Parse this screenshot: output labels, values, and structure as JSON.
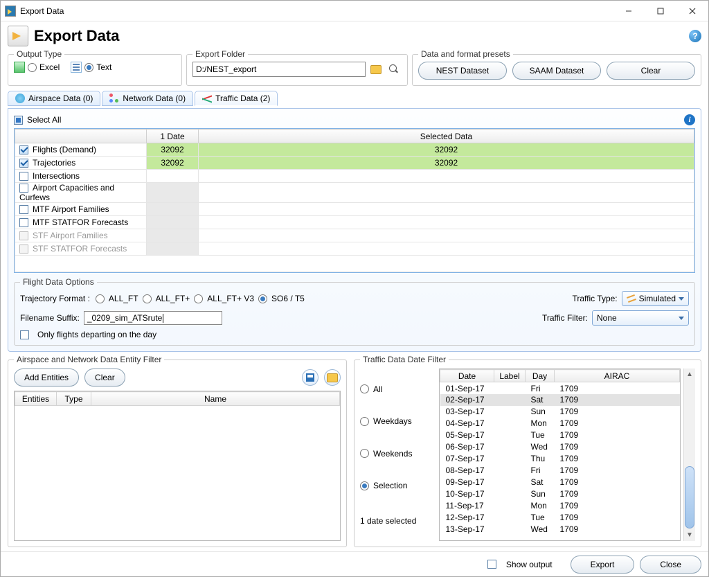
{
  "window": {
    "title": "Export Data",
    "heading": "Export Data"
  },
  "outputType": {
    "legend": "Output Type",
    "excel": "Excel",
    "text": "Text",
    "selected": "text"
  },
  "exportFolder": {
    "legend": "Export Folder",
    "path": "D:/NEST_export"
  },
  "presets": {
    "legend": "Data and format presets",
    "nest": "NEST Dataset",
    "saam": "SAAM Dataset",
    "clear": "Clear"
  },
  "tabs": {
    "airspace": "Airspace Data (0)",
    "network": "Network Data (0)",
    "traffic": "Traffic Data (2)"
  },
  "trafficPanel": {
    "selectAll": "Select All",
    "headers": {
      "date": "1 Date",
      "selected": "Selected Data"
    },
    "rows": [
      {
        "label": "Flights (Demand)",
        "checked": true,
        "date": "32092",
        "sel": "32092"
      },
      {
        "label": "Trajectories",
        "checked": true,
        "date": "32092",
        "sel": "32092"
      },
      {
        "label": "Intersections",
        "checked": false,
        "date": "",
        "sel": ""
      },
      {
        "label": "Airport Capacities and Curfews",
        "checked": false,
        "date": "",
        "sel": "",
        "dimdate": true
      },
      {
        "label": "MTF Airport Families",
        "checked": false,
        "date": "",
        "sel": "",
        "dimdate": true
      },
      {
        "label": "MTF STATFOR Forecasts",
        "checked": false,
        "date": "",
        "sel": "",
        "dimdate": true
      },
      {
        "label": "STF Airport Families",
        "checked": false,
        "date": "",
        "sel": "",
        "disabled": true,
        "dimdate": true
      },
      {
        "label": "STF STATFOR Forecasts",
        "checked": false,
        "date": "",
        "sel": "",
        "disabled": true,
        "dimdate": true
      }
    ]
  },
  "fdo": {
    "legend": "Flight Data Options",
    "trajFormatLabel": "Trajectory Format :",
    "formats": {
      "allft": "ALL_FT",
      "allftp": "ALL_FT+",
      "allftv3": "ALL_FT+ V3",
      "so6": "SO6 / T5"
    },
    "trafficTypeLabel": "Traffic Type:",
    "trafficTypeValue": "Simulated",
    "trafficFilterLabel": "Traffic Filter:",
    "trafficFilterValue": "None",
    "suffixLabel": "Filename Suffix:",
    "suffixValue": "_0209_sim_ATSrute",
    "onlyDepart": "Only flights departing on the day"
  },
  "entityFilter": {
    "legend": "Airspace and Network Data Entity Filter",
    "addEntities": "Add Entities",
    "clear": "Clear",
    "headers": {
      "entities": "Entities",
      "type": "Type",
      "name": "Name"
    }
  },
  "dateFilter": {
    "legend": "Traffic Data Date Filter",
    "radios": {
      "all": "All",
      "weekdays": "Weekdays",
      "weekends": "Weekends",
      "selection": "Selection"
    },
    "headers": {
      "date": "Date",
      "label": "Label",
      "day": "Day",
      "airac": "AIRAC"
    },
    "status": "1 date selected",
    "rows": [
      {
        "date": "01-Sep-17",
        "label": "",
        "day": "Fri",
        "airac": "1709"
      },
      {
        "date": "02-Sep-17",
        "label": "",
        "day": "Sat",
        "airac": "1709",
        "hl": true
      },
      {
        "date": "03-Sep-17",
        "label": "",
        "day": "Sun",
        "airac": "1709"
      },
      {
        "date": "04-Sep-17",
        "label": "",
        "day": "Mon",
        "airac": "1709"
      },
      {
        "date": "05-Sep-17",
        "label": "",
        "day": "Tue",
        "airac": "1709"
      },
      {
        "date": "06-Sep-17",
        "label": "",
        "day": "Wed",
        "airac": "1709"
      },
      {
        "date": "07-Sep-17",
        "label": "",
        "day": "Thu",
        "airac": "1709"
      },
      {
        "date": "08-Sep-17",
        "label": "",
        "day": "Fri",
        "airac": "1709"
      },
      {
        "date": "09-Sep-17",
        "label": "",
        "day": "Sat",
        "airac": "1709"
      },
      {
        "date": "10-Sep-17",
        "label": "",
        "day": "Sun",
        "airac": "1709"
      },
      {
        "date": "11-Sep-17",
        "label": "",
        "day": "Mon",
        "airac": "1709"
      },
      {
        "date": "12-Sep-17",
        "label": "",
        "day": "Tue",
        "airac": "1709"
      },
      {
        "date": "13-Sep-17",
        "label": "",
        "day": "Wed",
        "airac": "1709"
      }
    ]
  },
  "footer": {
    "showOutput": "Show output",
    "export": "Export",
    "close": "Close"
  }
}
